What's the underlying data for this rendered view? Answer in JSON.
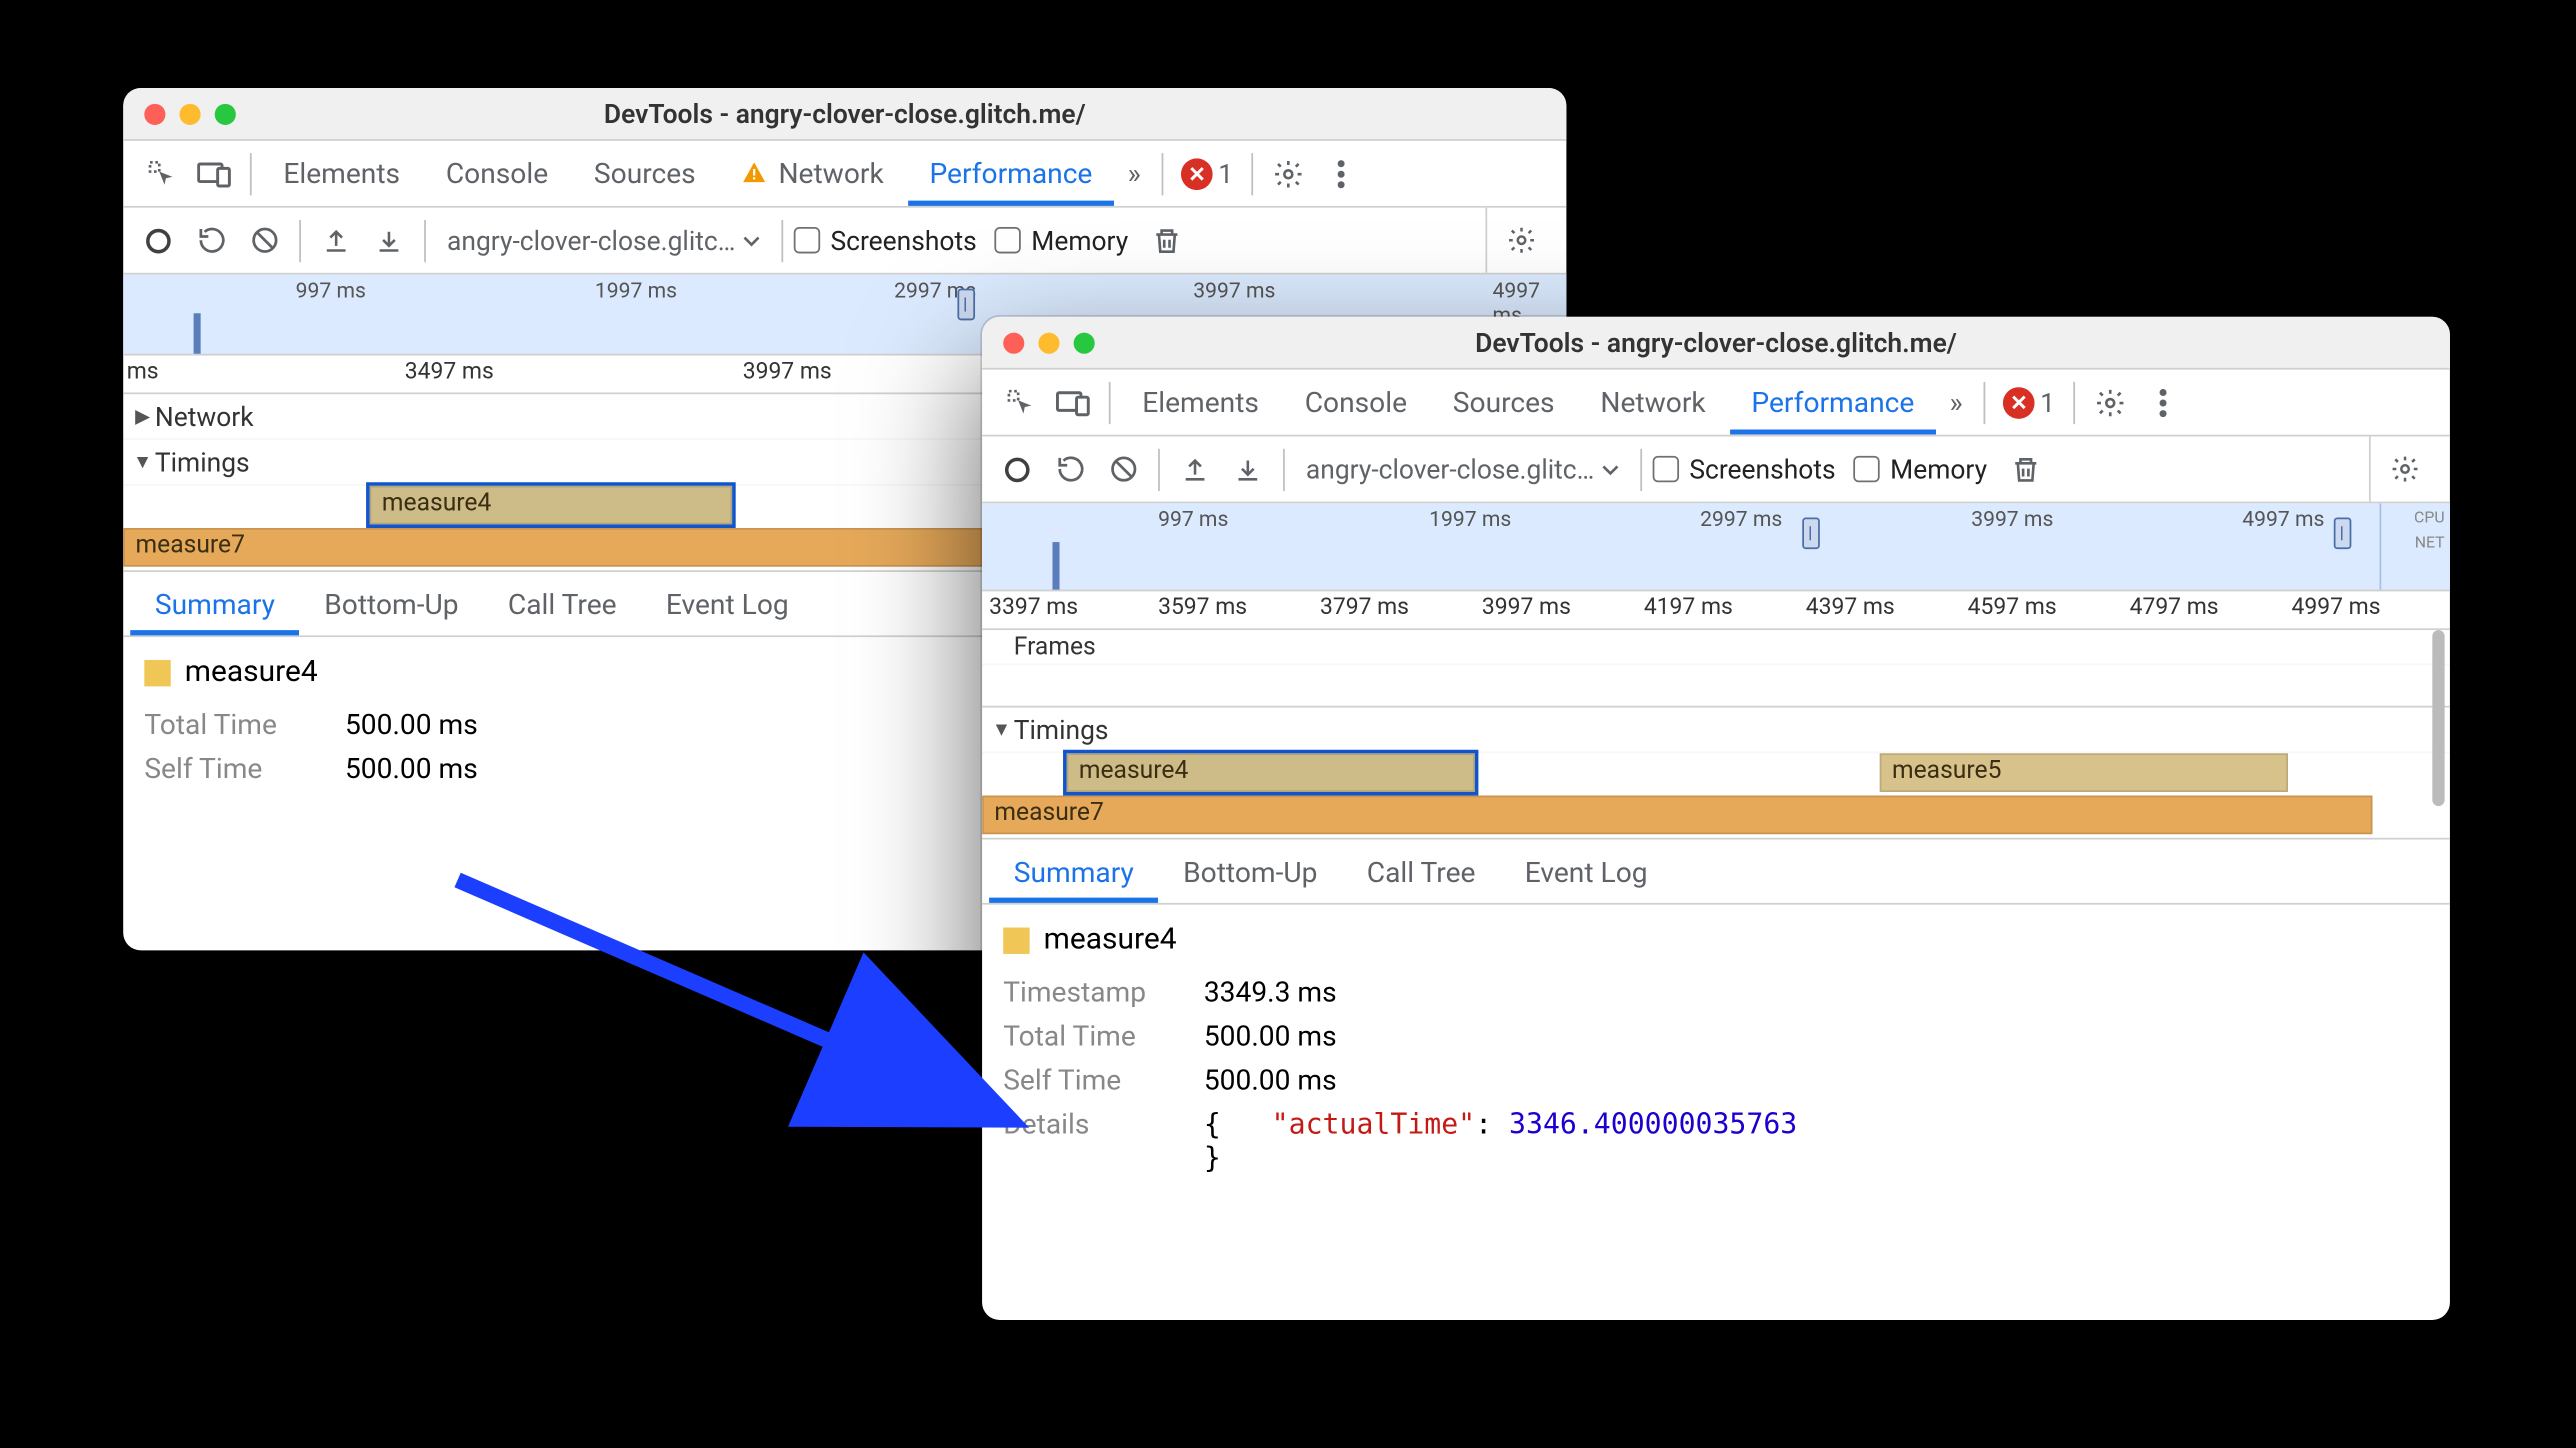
{
  "window_title": "DevTools - angry-clover-close.glitch.me/",
  "url_dropdown": "angry-clover-close.glitc…",
  "tabs": {
    "elements": "Elements",
    "console": "Console",
    "sources": "Sources",
    "network": "Network",
    "performance": "Performance",
    "more_glyph": "»"
  },
  "error_count": "1",
  "toolbar": {
    "screenshots": "Screenshots",
    "memory": "Memory"
  },
  "overview_ticks_left": [
    "997 ms",
    "1997 ms",
    "2997 ms",
    "3997 ms",
    "4997 ms"
  ],
  "overview_ticks_right": [
    "997 ms",
    "1997 ms",
    "2997 ms",
    "3997 ms",
    "4997 ms"
  ],
  "overview_side": {
    "cpu": "CPU",
    "net": "NET"
  },
  "ruler_left_ms": "ms",
  "ruler_left": [
    "3497 ms",
    "3997 ms"
  ],
  "ruler_right": [
    "3397 ms",
    "3597 ms",
    "3797 ms",
    "3997 ms",
    "4197 ms",
    "4397 ms",
    "4597 ms",
    "4797 ms",
    "4997 ms"
  ],
  "tracks": {
    "network": "Network",
    "frames": "Frames",
    "timings": "Timings",
    "measure4": "measure4",
    "measure5": "measure5",
    "measure7": "measure7"
  },
  "detail_tabs": {
    "summary": "Summary",
    "bottom_up": "Bottom-Up",
    "call_tree": "Call Tree",
    "event_log": "Event Log"
  },
  "details_left": {
    "title": "measure4",
    "total_time_k": "Total Time",
    "total_time_v": "500.00 ms",
    "self_time_k": "Self Time",
    "self_time_v": "500.00 ms"
  },
  "details_right": {
    "title": "measure4",
    "timestamp_k": "Timestamp",
    "timestamp_v": "3349.3 ms",
    "total_time_k": "Total Time",
    "total_time_v": "500.00 ms",
    "self_time_k": "Self Time",
    "self_time_v": "500.00 ms",
    "details_k": "Details",
    "json_open": "{",
    "json_key": "\"actualTime\"",
    "json_colon": ": ",
    "json_val": "3346.400000035763",
    "json_close": "}"
  }
}
